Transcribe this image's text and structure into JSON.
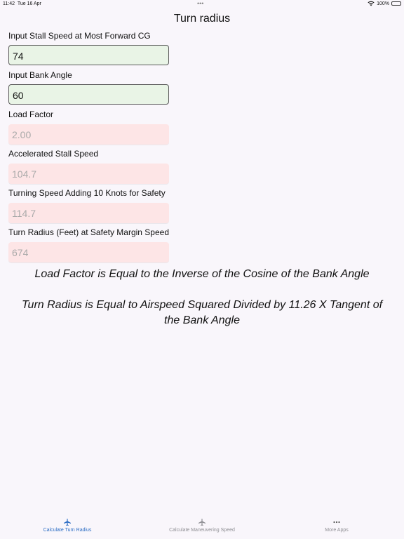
{
  "status": {
    "time": "11:42",
    "date": "Tue 16 Apr",
    "battery": "100%"
  },
  "nav": {
    "title": "Turn radius"
  },
  "fields": [
    {
      "label": "Input Stall Speed at Most Forward CG",
      "value": "74"
    },
    {
      "label": "Input Bank Angle",
      "value": "60"
    },
    {
      "label": "Load Factor",
      "value": "2.00"
    },
    {
      "label": "Accelerated Stall Speed",
      "value": "104.7"
    },
    {
      "label": "Turning Speed Adding 10 Knots for Safety",
      "value": "114.7"
    },
    {
      "label": "Turn Radius (Feet) at Safety Margin Speed",
      "value": "674"
    }
  ],
  "formulas": {
    "load_factor": "Load Factor is Equal to the Inverse of the Cosine of the Bank Angle",
    "turn_radius": "Turn Radius is Equal to Airspeed Squared Divided by 11.26 X Tangent of the Bank Angle"
  },
  "tabs": [
    {
      "label": "Calculate Turn Radius",
      "icon": "airplane-icon",
      "active": true
    },
    {
      "label": "Calculate Maneuvering Speed",
      "icon": "airplane-icon",
      "active": false
    },
    {
      "label": "More Apps",
      "icon": "ellipsis-icon",
      "active": false
    }
  ],
  "colors": {
    "accent": "#2a6cc4",
    "input_bg": "#e9f4e6",
    "output_bg": "#fde5e6"
  }
}
